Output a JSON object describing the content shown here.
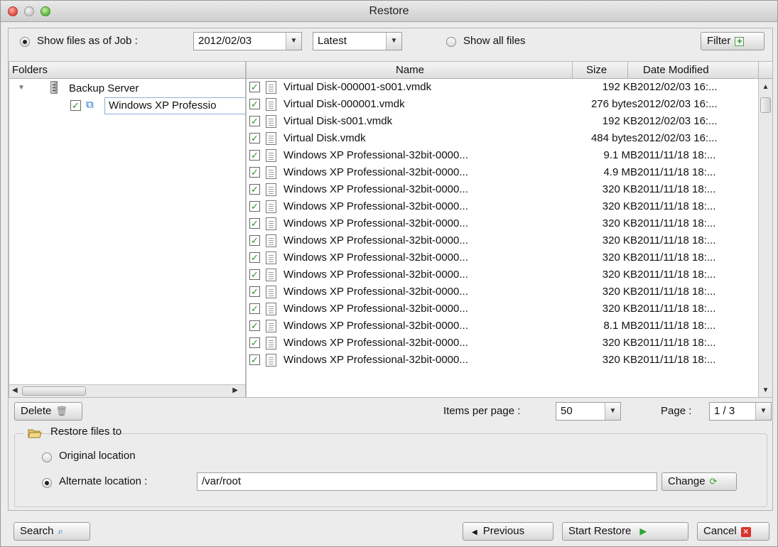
{
  "window": {
    "title": "Restore"
  },
  "top": {
    "show_as_of_label": "Show files as of Job :",
    "job_date": "2012/02/03",
    "version": "Latest",
    "show_all_label": "Show all files",
    "filter_label": "Filter"
  },
  "folders": {
    "header": "Folders",
    "server": "Backup Server",
    "vm": "Windows XP Professio"
  },
  "files": {
    "headers": {
      "name": "Name",
      "size": "Size",
      "date": "Date Modified"
    },
    "rows": [
      {
        "name": "Virtual Disk-000001-s001.vmdk",
        "size": "192 KB",
        "date": "2012/02/03 16:..."
      },
      {
        "name": "Virtual Disk-000001.vmdk",
        "size": "276 bytes",
        "date": "2012/02/03 16:..."
      },
      {
        "name": "Virtual Disk-s001.vmdk",
        "size": "192 KB",
        "date": "2012/02/03 16:..."
      },
      {
        "name": "Virtual Disk.vmdk",
        "size": "484 bytes",
        "date": "2012/02/03 16:..."
      },
      {
        "name": "Windows XP Professional-32bit-0000...",
        "size": "9.1 MB",
        "date": "2011/11/18 18:..."
      },
      {
        "name": "Windows XP Professional-32bit-0000...",
        "size": "4.9 MB",
        "date": "2011/11/18 18:..."
      },
      {
        "name": "Windows XP Professional-32bit-0000...",
        "size": "320 KB",
        "date": "2011/11/18 18:..."
      },
      {
        "name": "Windows XP Professional-32bit-0000...",
        "size": "320 KB",
        "date": "2011/11/18 18:..."
      },
      {
        "name": "Windows XP Professional-32bit-0000...",
        "size": "320 KB",
        "date": "2011/11/18 18:..."
      },
      {
        "name": "Windows XP Professional-32bit-0000...",
        "size": "320 KB",
        "date": "2011/11/18 18:..."
      },
      {
        "name": "Windows XP Professional-32bit-0000...",
        "size": "320 KB",
        "date": "2011/11/18 18:..."
      },
      {
        "name": "Windows XP Professional-32bit-0000...",
        "size": "320 KB",
        "date": "2011/11/18 18:..."
      },
      {
        "name": "Windows XP Professional-32bit-0000...",
        "size": "320 KB",
        "date": "2011/11/18 18:..."
      },
      {
        "name": "Windows XP Professional-32bit-0000...",
        "size": "320 KB",
        "date": "2011/11/18 18:..."
      },
      {
        "name": "Windows XP Professional-32bit-0000...",
        "size": "8.1 MB",
        "date": "2011/11/18 18:..."
      },
      {
        "name": "Windows XP Professional-32bit-0000...",
        "size": "320 KB",
        "date": "2011/11/18 18:..."
      },
      {
        "name": "Windows XP Professional-32bit-0000...",
        "size": "320 KB",
        "date": "2011/11/18 18:..."
      }
    ]
  },
  "pager": {
    "delete_label": "Delete",
    "items_per_page_label": "Items per page :",
    "items_per_page": "50",
    "page_label": "Page :",
    "page_value": "1 / 3"
  },
  "restore_to": {
    "legend": "Restore files to",
    "original_label": "Original location",
    "alternate_label": "Alternate location :",
    "alternate_path": "/var/root",
    "change_label": "Change"
  },
  "footer": {
    "search_label": "Search",
    "previous_label": "Previous",
    "start_label": "Start Restore",
    "cancel_label": "Cancel"
  },
  "colors": {
    "check": "#2f8a2f",
    "vm_icon": "#1f6fd8",
    "cancel_icon": "#d9322c",
    "start_icon": "#2fa52f"
  }
}
